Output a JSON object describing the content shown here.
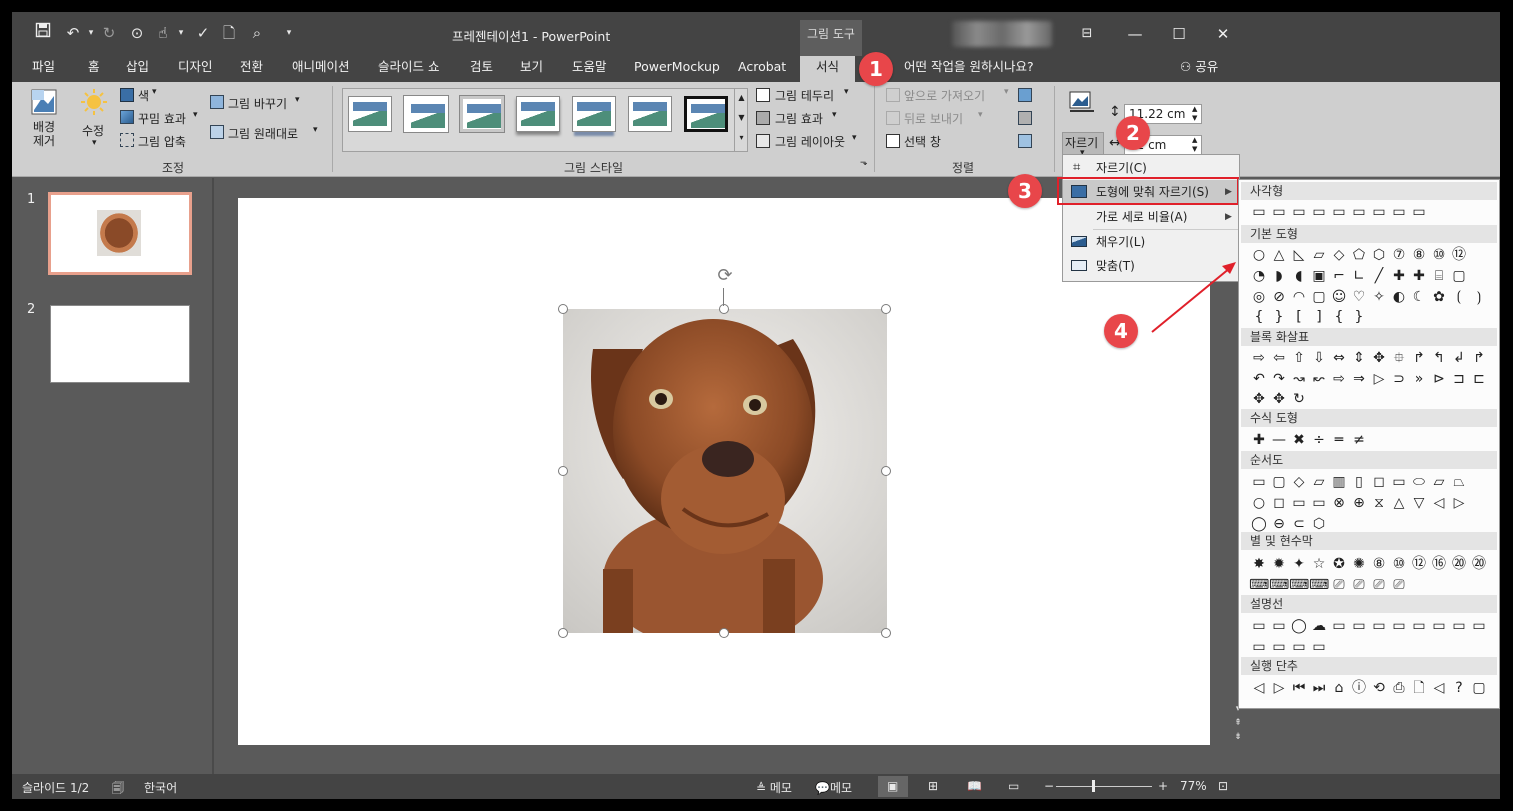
{
  "titlebar": {
    "title": "프레젠테이션1  -  PowerPoint",
    "tool_group": "그림 도구",
    "quick_access_more": "▾"
  },
  "tabs": [
    "파일",
    "홈",
    "삽입",
    "디자인",
    "전환",
    "애니메이션",
    "슬라이드 쇼",
    "검토",
    "보기",
    "도움말",
    "PowerMockup",
    "Acrobat",
    "서식"
  ],
  "tell_me": "어떤 작업을 원하시나요?",
  "share": "공유",
  "ribbon": {
    "adjust": {
      "remove_bg": "배경\n제거",
      "corrections": "수정",
      "color": "색",
      "artistic": "꾸밈 효과",
      "compress": "그림 압축",
      "change": "그림 바꾸기",
      "reset": "그림 원래대로",
      "group_label": "조정"
    },
    "styles": {
      "border": "그림 테두리",
      "effects": "그림 효과",
      "layout": "그림 레이아웃",
      "group_label": "그림 스타일"
    },
    "arrange": {
      "bring_forward": "앞으로 가져오기",
      "send_backward": "뒤로 보내기",
      "selection_pane": "선택 창",
      "group_label": "정렬"
    },
    "size": {
      "crop": "자르기",
      "height": "11.22 cm",
      "width": "22 cm"
    }
  },
  "slides": [
    "1",
    "2"
  ],
  "crop_menu": [
    {
      "label": "자르기(C)",
      "icon": "crop-icon",
      "submenu": false
    },
    {
      "label": "도형에 맞춰 자르기(S)",
      "icon": "crop-to-shape-icon",
      "submenu": true
    },
    {
      "label": "가로 세로 비율(A)",
      "icon": "",
      "submenu": true
    },
    {
      "label": "채우기(L)",
      "icon": "fill-icon",
      "submenu": false
    },
    {
      "label": "맞춤(T)",
      "icon": "fit-icon",
      "submenu": false
    }
  ],
  "shape_categories": [
    "사각형",
    "기본 도형",
    "블록 화살표",
    "수식 도형",
    "순서도",
    "별 및 현수막",
    "설명선",
    "실행 단추"
  ],
  "badges": [
    "1",
    "2",
    "3",
    "4"
  ],
  "statusbar": {
    "slide_info": "슬라이드 1/2",
    "language": "한국어",
    "notes": "메모",
    "comments": "메모",
    "zoom": "77%",
    "zoom_minus": "−",
    "zoom_plus": "+"
  },
  "colors": {
    "accent_red": "#e8464a",
    "ribbon_bg": "#cfcfcf",
    "titlebar_bg": "#444444"
  }
}
